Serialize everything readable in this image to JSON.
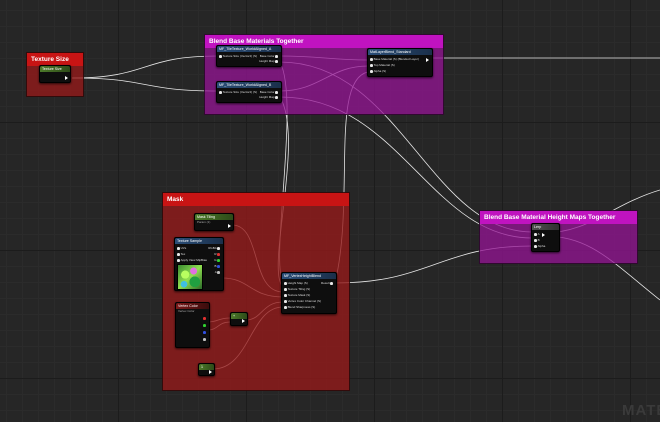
{
  "comments": {
    "texture_size": "Texture Size",
    "blend_base": "Blend Base Materials Together",
    "mask": "Mask",
    "height_maps": "Blend Base Material Height Maps Together"
  },
  "nodes": {
    "texture_size_param": {
      "title": "Texture Size"
    },
    "mf_a": {
      "title": "MF_TileTexture_WorldAligned_A",
      "pin1": "Texture Size (Vector2) (S)",
      "pin2": "Height Map",
      "out1": "Base Color",
      "out2": "Height Map"
    },
    "mf_b": {
      "title": "MF_TileTexture_WorldAligned_B",
      "pin1": "Texture Size (Vector2) (S)",
      "pin2": "Height Map",
      "out1": "Base Color",
      "out2": "Height Map"
    },
    "mat_layers": {
      "title": "MatLayerBlend_Standard",
      "pin1": "Base Material (S) (Blended Layer)",
      "pin2": "Top Material (S)",
      "pin3": "Alpha (S)"
    },
    "lerp": {
      "title": "Lerp",
      "pin_a": "A",
      "pin_b": "B",
      "pin_alpha": "Alpha"
    },
    "mask_tiling": {
      "title": "Mask Tiling",
      "sub": "Param (1)"
    },
    "texture_sample": {
      "title": "Texture Sample",
      "uvs": "UVs",
      "tex": "Tex",
      "apply_mip": "Apply View MipBias",
      "r": "R",
      "g": "G",
      "b": "B",
      "a": "A",
      "rgba": "RGBA"
    },
    "vertex_color": {
      "title": "Vertex Color",
      "sub": "Vertex Color"
    },
    "height_blend": {
      "title": "MF_VertexHeightBlend",
      "pin1": "Height Map (S)",
      "pin2": "Texture Tiling (S)",
      "pin3": "Texture Mask (S)",
      "pin4": "Vertex Color Channel (S)",
      "pin5": "Blend Sharpness (S)",
      "out": "Result"
    },
    "add_node": {
      "title": "+"
    },
    "const_node": {
      "title": "1"
    }
  },
  "watermark": "MATE"
}
